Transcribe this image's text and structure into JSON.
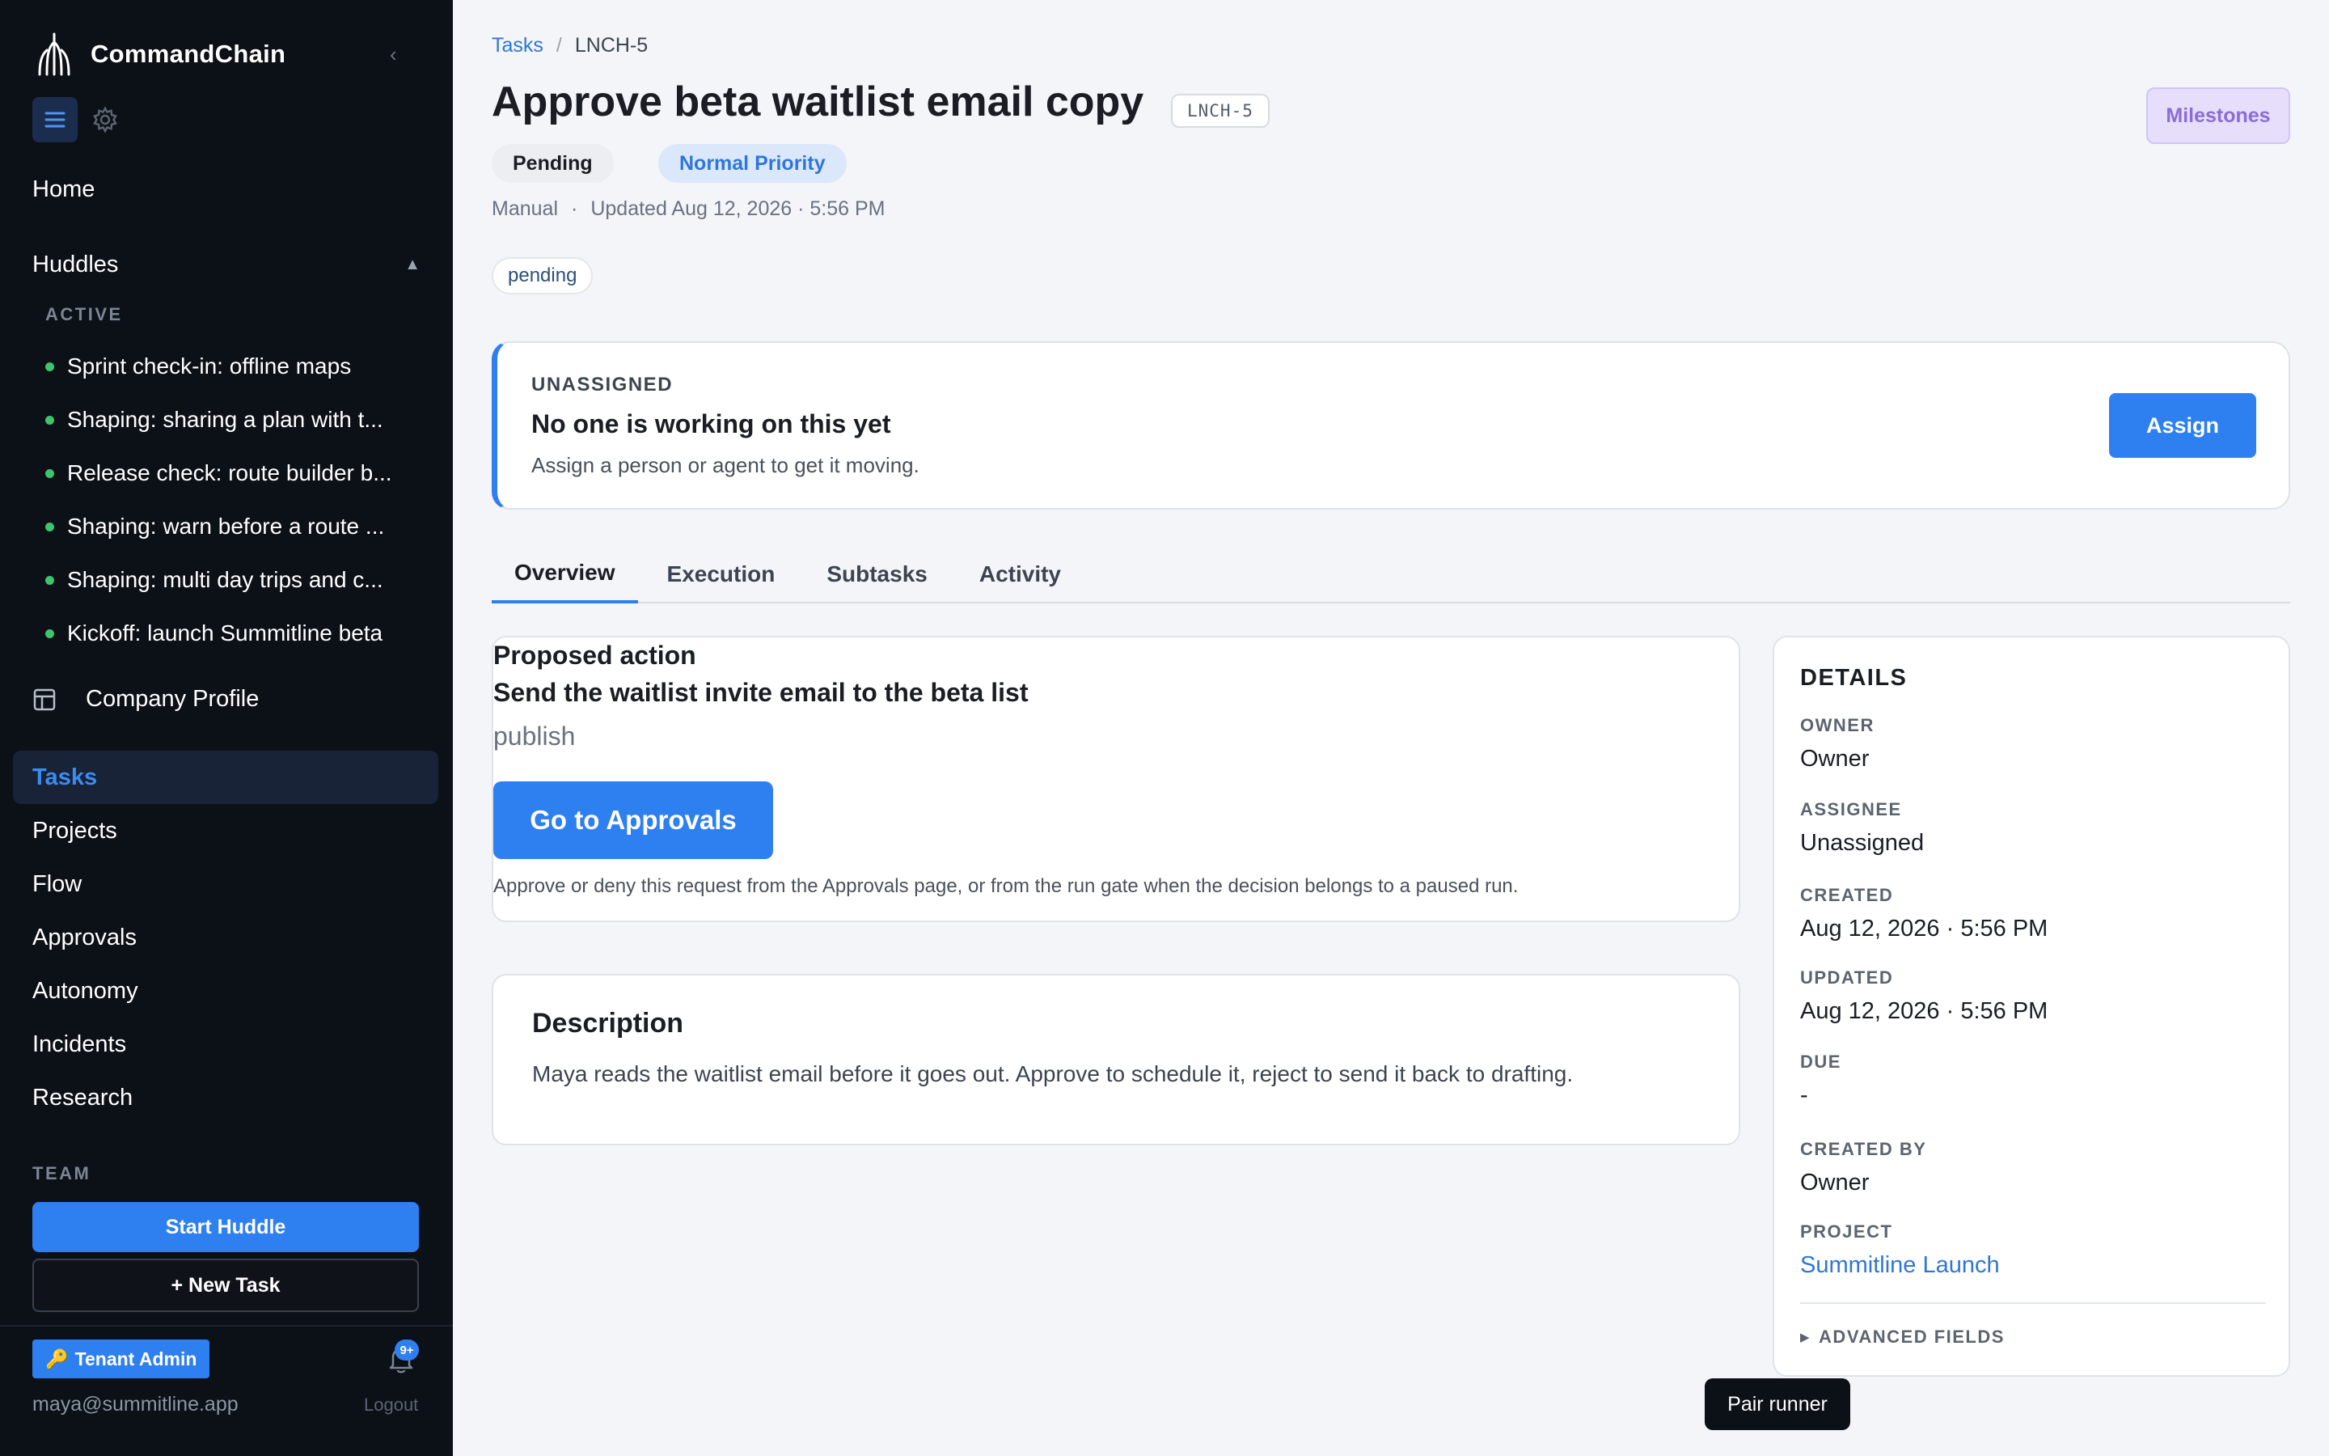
{
  "app": {
    "name": "CommandChain"
  },
  "sidebar": {
    "home_label": "Home",
    "huddles": {
      "label": "Huddles",
      "caret": "▲",
      "active_label": "ACTIVE",
      "items": [
        {
          "label": "Sprint check-in: offline maps"
        },
        {
          "label": "Shaping: sharing a plan with t..."
        },
        {
          "label": "Release check: route builder b..."
        },
        {
          "label": "Shaping: warn before a route ..."
        },
        {
          "label": "Shaping: multi day trips and c..."
        },
        {
          "label": "Kickoff: launch Summitline beta"
        }
      ]
    },
    "company_profile_label": "Company Profile",
    "nav": [
      {
        "label": "Tasks",
        "active": true
      },
      {
        "label": "Projects"
      },
      {
        "label": "Flow"
      },
      {
        "label": "Approvals"
      },
      {
        "label": "Autonomy"
      },
      {
        "label": "Incidents"
      },
      {
        "label": "Research"
      }
    ],
    "team_label": "TEAM",
    "start_huddle_label": "Start Huddle",
    "new_task_label": "+ New Task",
    "tenant_badge": {
      "icon": "key-icon",
      "label": "Tenant Admin"
    },
    "notifications_count": "9+",
    "user_email": "maya@summitline.app",
    "logout_label": "Logout"
  },
  "breadcrumb": {
    "parent": "Tasks",
    "separator": "/",
    "current": "LNCH-5"
  },
  "task": {
    "title": "Approve beta waitlist email copy",
    "key": "LNCH-5",
    "status": "Pending",
    "priority": "Normal Priority",
    "source": "Manual",
    "meta_dot": "·",
    "updated": "Updated Aug 12, 2026 · 5:56 PM",
    "tag": "pending"
  },
  "header_actions": {
    "milestones_label": "Milestones"
  },
  "unassigned": {
    "label": "UNASSIGNED",
    "title": "No one is working on this yet",
    "subtitle": "Assign a person or agent to get it moving.",
    "assign_label": "Assign"
  },
  "tabs": [
    {
      "label": "Overview",
      "active": true
    },
    {
      "label": "Execution"
    },
    {
      "label": "Subtasks"
    },
    {
      "label": "Activity"
    }
  ],
  "proposed": {
    "label": "Proposed action",
    "action": "Send the waitlist invite email to the beta list",
    "kind": "publish",
    "button_label": "Go to Approvals",
    "note": "Approve or deny this request from the Approvals page, or from the run gate when the decision belongs to a paused run."
  },
  "description": {
    "title": "Description",
    "text": "Maya reads the waitlist email before it goes out. Approve to schedule it, reject to send it back to drafting."
  },
  "details": {
    "heading": "DETAILS",
    "owner_label": "OWNER",
    "owner": "Owner",
    "assignee_label": "ASSIGNEE",
    "assignee": "Unassigned",
    "created_label": "CREATED",
    "created": "Aug 12, 2026 · 5:56 PM",
    "updated_label": "UPDATED",
    "updated": "Aug 12, 2026 · 5:56 PM",
    "due_label": "DUE",
    "due": "-",
    "created_by_label": "CREATED BY",
    "created_by": "Owner",
    "project_label": "PROJECT",
    "project": "Summitline Launch",
    "advanced_label": "ADVANCED FIELDS"
  },
  "pair_runner_label": "Pair runner",
  "colors": {
    "accent": "#2e7ff0",
    "sidebar_bg": "#0c1017",
    "page_bg": "#f3f5f8",
    "active_dot": "#3ec46d",
    "milestones": "#8a6dd6"
  }
}
